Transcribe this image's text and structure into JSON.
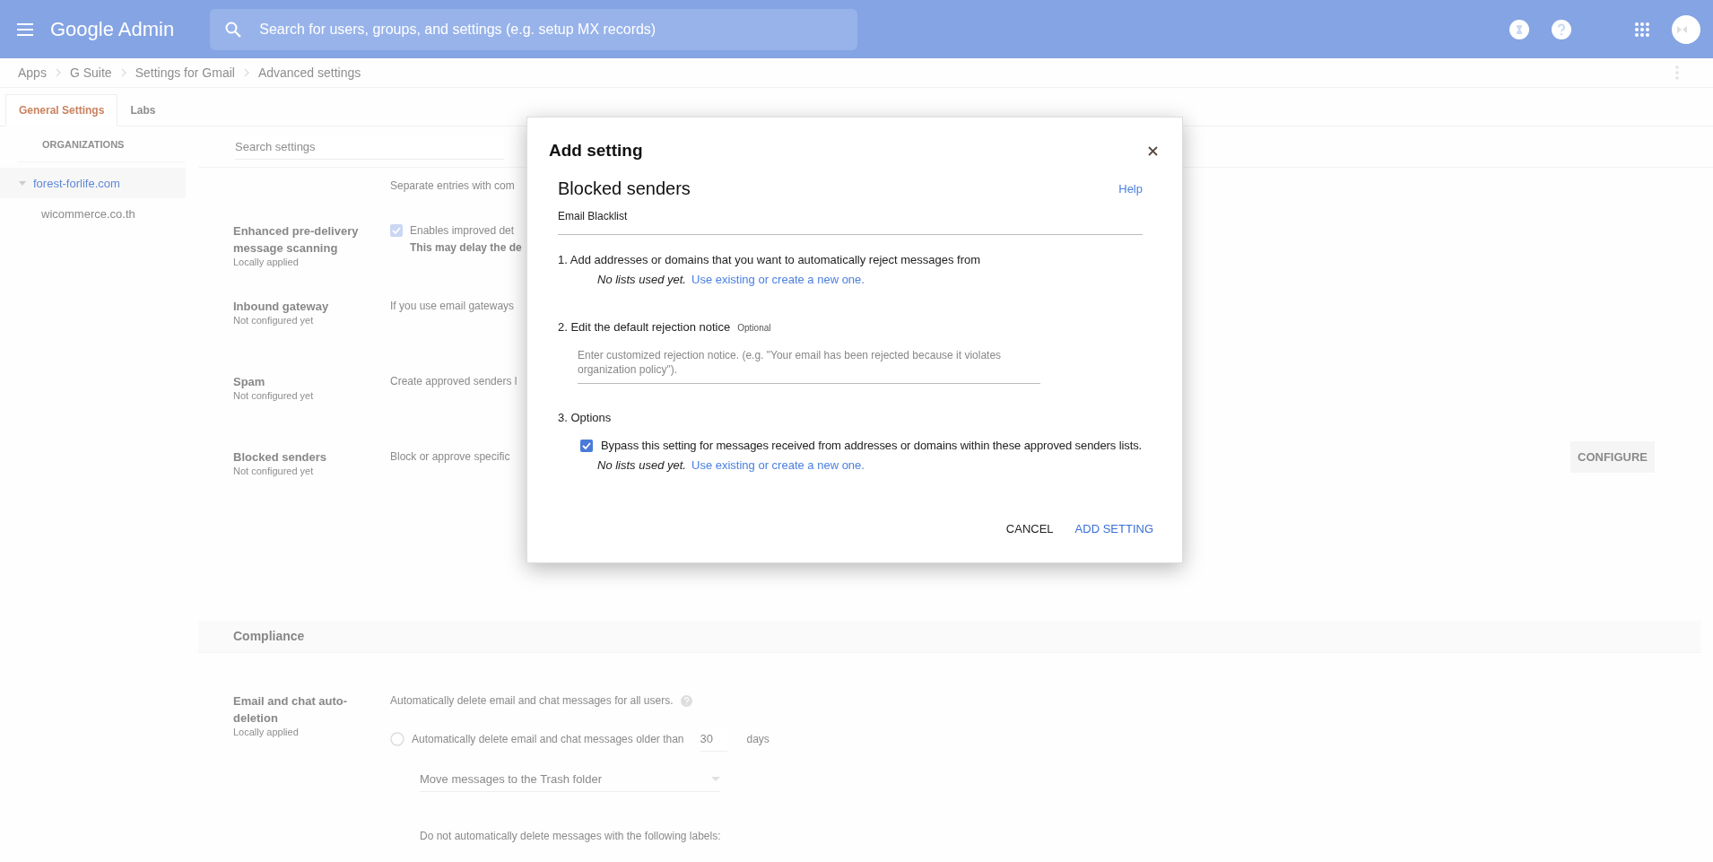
{
  "header": {
    "app_name": "Google Admin",
    "search_placeholder": "Search for users, groups, and settings (e.g. setup MX records)"
  },
  "breadcrumb": [
    "Apps",
    "G Suite",
    "Settings for Gmail",
    "Advanced settings"
  ],
  "tabs": [
    {
      "label": "General Settings",
      "selected": true
    },
    {
      "label": "Labs",
      "selected": false
    }
  ],
  "sidebar": {
    "heading": "ORGANIZATIONS",
    "items": [
      {
        "label": "forest-forlife.com",
        "selected": true,
        "expanded": true,
        "children": [
          {
            "label": "wicommerce.co.th",
            "selected": false
          }
        ]
      }
    ]
  },
  "settings": {
    "search_placeholder": "Search settings",
    "rows": [
      {
        "kind": "text",
        "description": "Separate entries with com"
      },
      {
        "kind": "checkbox",
        "name": "Enhanced pre-delivery message scanning",
        "status": "Locally applied",
        "checked": true,
        "description": "Enables improved det",
        "note": "This may delay the de"
      },
      {
        "kind": "text",
        "name": "Inbound gateway",
        "status": "Not configured yet",
        "description": "If you use email gateways"
      },
      {
        "kind": "text",
        "name": "Spam",
        "status": "Not configured yet",
        "description": "Create approved senders l"
      },
      {
        "kind": "button",
        "name": "Blocked senders",
        "status": "Not configured yet",
        "description": "Block or approve specific",
        "button": "CONFIGURE"
      }
    ]
  },
  "compliance": {
    "title": "Compliance",
    "name": "Email and chat auto-deletion",
    "status": "Locally applied",
    "description": "Automatically delete email and chat messages for all users.",
    "radio": {
      "label": "Automatically delete email and chat messages older than",
      "selected": false,
      "value": "30",
      "unit": "days"
    },
    "dropdown": "Move messages to the Trash folder",
    "note": "Do not automatically delete messages with the following labels:"
  },
  "dialog": {
    "title": "Add setting",
    "setting_name": "Blocked senders",
    "help": "Help",
    "subtitle": "Email Blacklist",
    "step1": {
      "label": "1. Add addresses or domains that you want to automatically reject messages from",
      "note": "No lists used yet.",
      "link": "Use existing or create a new one."
    },
    "step2": {
      "label": "2. Edit the default rejection notice",
      "tag": "Optional",
      "placeholder": "Enter customized rejection notice. (e.g. \"Your email has been rejected because it violates organization policy\")."
    },
    "step3": {
      "label": "3. Options",
      "checkbox": {
        "label": "Bypass this setting for messages received from addresses or domains within these approved senders lists.",
        "checked": true
      },
      "note": "No lists used yet.",
      "link": "Use existing or create a new one."
    },
    "buttons": [
      {
        "label": "CANCEL",
        "primary": false
      },
      {
        "label": "ADD SETTING",
        "primary": true
      }
    ]
  }
}
